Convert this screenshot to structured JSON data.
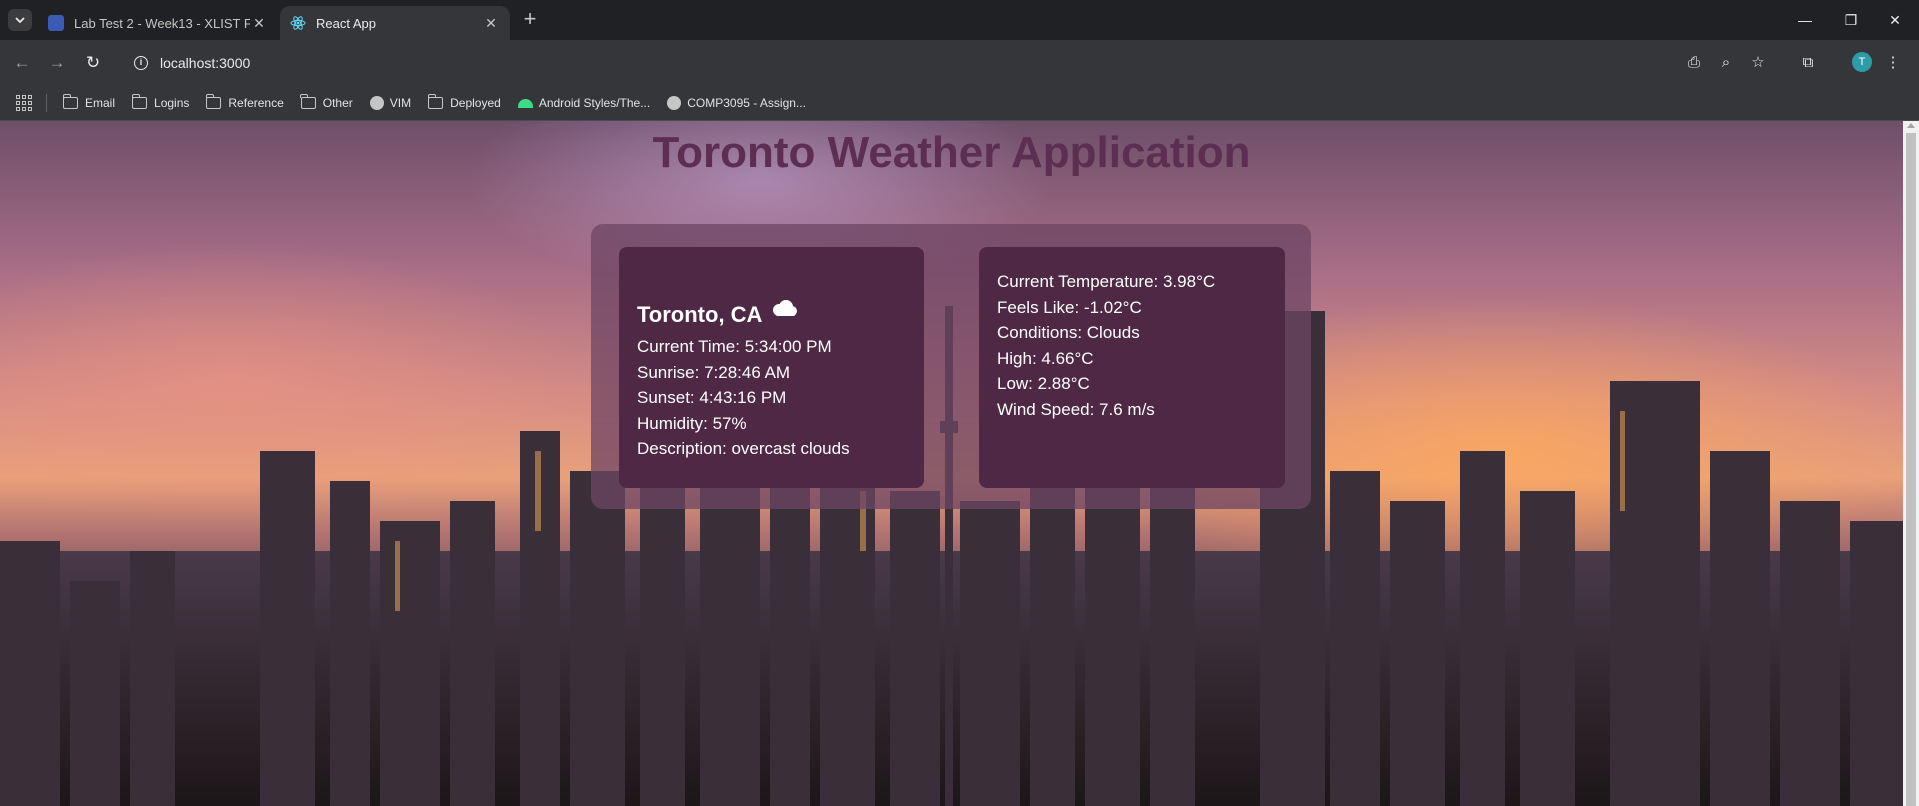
{
  "browser": {
    "tabs": [
      {
        "title": "Lab Test 2 - Week13 - XLIST Fall",
        "active": false
      },
      {
        "title": "React App",
        "active": true
      }
    ],
    "url": "localhost:3000",
    "profile_initial": "T",
    "bookmarks": [
      {
        "label": "Email",
        "icon": "folder-icon"
      },
      {
        "label": "Logins",
        "icon": "folder-icon"
      },
      {
        "label": "Reference",
        "icon": "folder-icon"
      },
      {
        "label": "Other",
        "icon": "folder-icon"
      },
      {
        "label": "VIM",
        "icon": "globe-icon"
      },
      {
        "label": "Deployed",
        "icon": "folder-icon"
      },
      {
        "label": "Android Styles/The...",
        "icon": "android-icon"
      },
      {
        "label": "COMP3095 - Assign...",
        "icon": "globe-icon"
      }
    ]
  },
  "page": {
    "title": "Toronto Weather Application",
    "location": {
      "city": "Toronto, CA",
      "weather_icon": "cloud-icon",
      "current_time": "Current Time: 5:34:00 PM",
      "sunrise": "Sunrise: 7:28:46 AM",
      "sunset": "Sunset: 4:43:16 PM",
      "humidity": "Humidity: 57%",
      "description": "Description: overcast clouds"
    },
    "conditions": {
      "current_temperature": "Current Temperature: 3.98°C",
      "feels_like": "Feels Like: -1.02°C",
      "conditions": "Conditions: Clouds",
      "high": "High: 4.66°C",
      "low": "Low: 2.88°C",
      "wind_speed": "Wind Speed: 7.6 m/s"
    }
  },
  "colors": {
    "title": "#5b2e52",
    "card": "#4e2844",
    "panel": "#6e4664"
  }
}
